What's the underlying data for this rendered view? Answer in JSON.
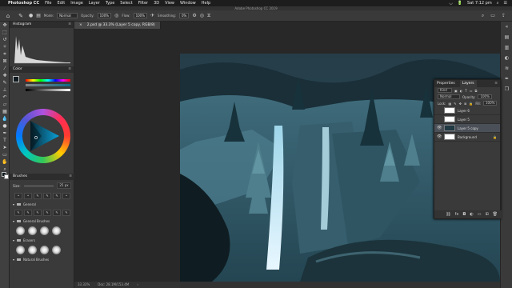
{
  "menubar": {
    "apple": "",
    "items": [
      "Photoshop CC",
      "File",
      "Edit",
      "Image",
      "Layer",
      "Type",
      "Select",
      "Filter",
      "3D",
      "View",
      "Window",
      "Help"
    ],
    "clock": "Sat 7:12 pm",
    "battery": "🔋",
    "wifi": "◡"
  },
  "app_title": "Adobe Photoshop CC 2019",
  "options": {
    "mode_label": "Mode:",
    "mode_value": "Normal",
    "opacity_label": "Opacity:",
    "opacity_value": "100%",
    "flow_label": "Flow:",
    "flow_value": "100%",
    "smoothing_label": "Smoothing:",
    "smoothing_value": "0%"
  },
  "document_tab": {
    "title": "2.psd @ 33.3% (Layer 5 copy, RGB/8)",
    "close": "×"
  },
  "status": {
    "zoom": "33.33%",
    "doc": "Doc: 28.1M/153.4M"
  },
  "panels": {
    "histogram_title": "Histogram",
    "color_title": "Color",
    "brushes_title": "Brushes",
    "brush_size_label": "Size:",
    "brush_size_value": "25 px",
    "brush_groups": [
      "General",
      "General Brushes",
      "Erasers",
      "Natural Brushes"
    ]
  },
  "layers_panel": {
    "tabs": [
      "Properties",
      "Layers"
    ],
    "kind_label": "Kind",
    "blend_mode": "Normal",
    "opacity_label": "Opacity:",
    "opacity_value": "100%",
    "lock_label": "Lock:",
    "fill_label": "Fill:",
    "fill_value": "100%",
    "layers": [
      {
        "name": "Layer 6",
        "visible": false,
        "selected": false
      },
      {
        "name": "Layer 5",
        "visible": false,
        "selected": false
      },
      {
        "name": "Layer 5 copy",
        "visible": true,
        "selected": true
      },
      {
        "name": "Background",
        "visible": true,
        "selected": false
      }
    ]
  },
  "colors": {
    "accent": "#4b5058",
    "artwork_base": "#1e3640"
  }
}
